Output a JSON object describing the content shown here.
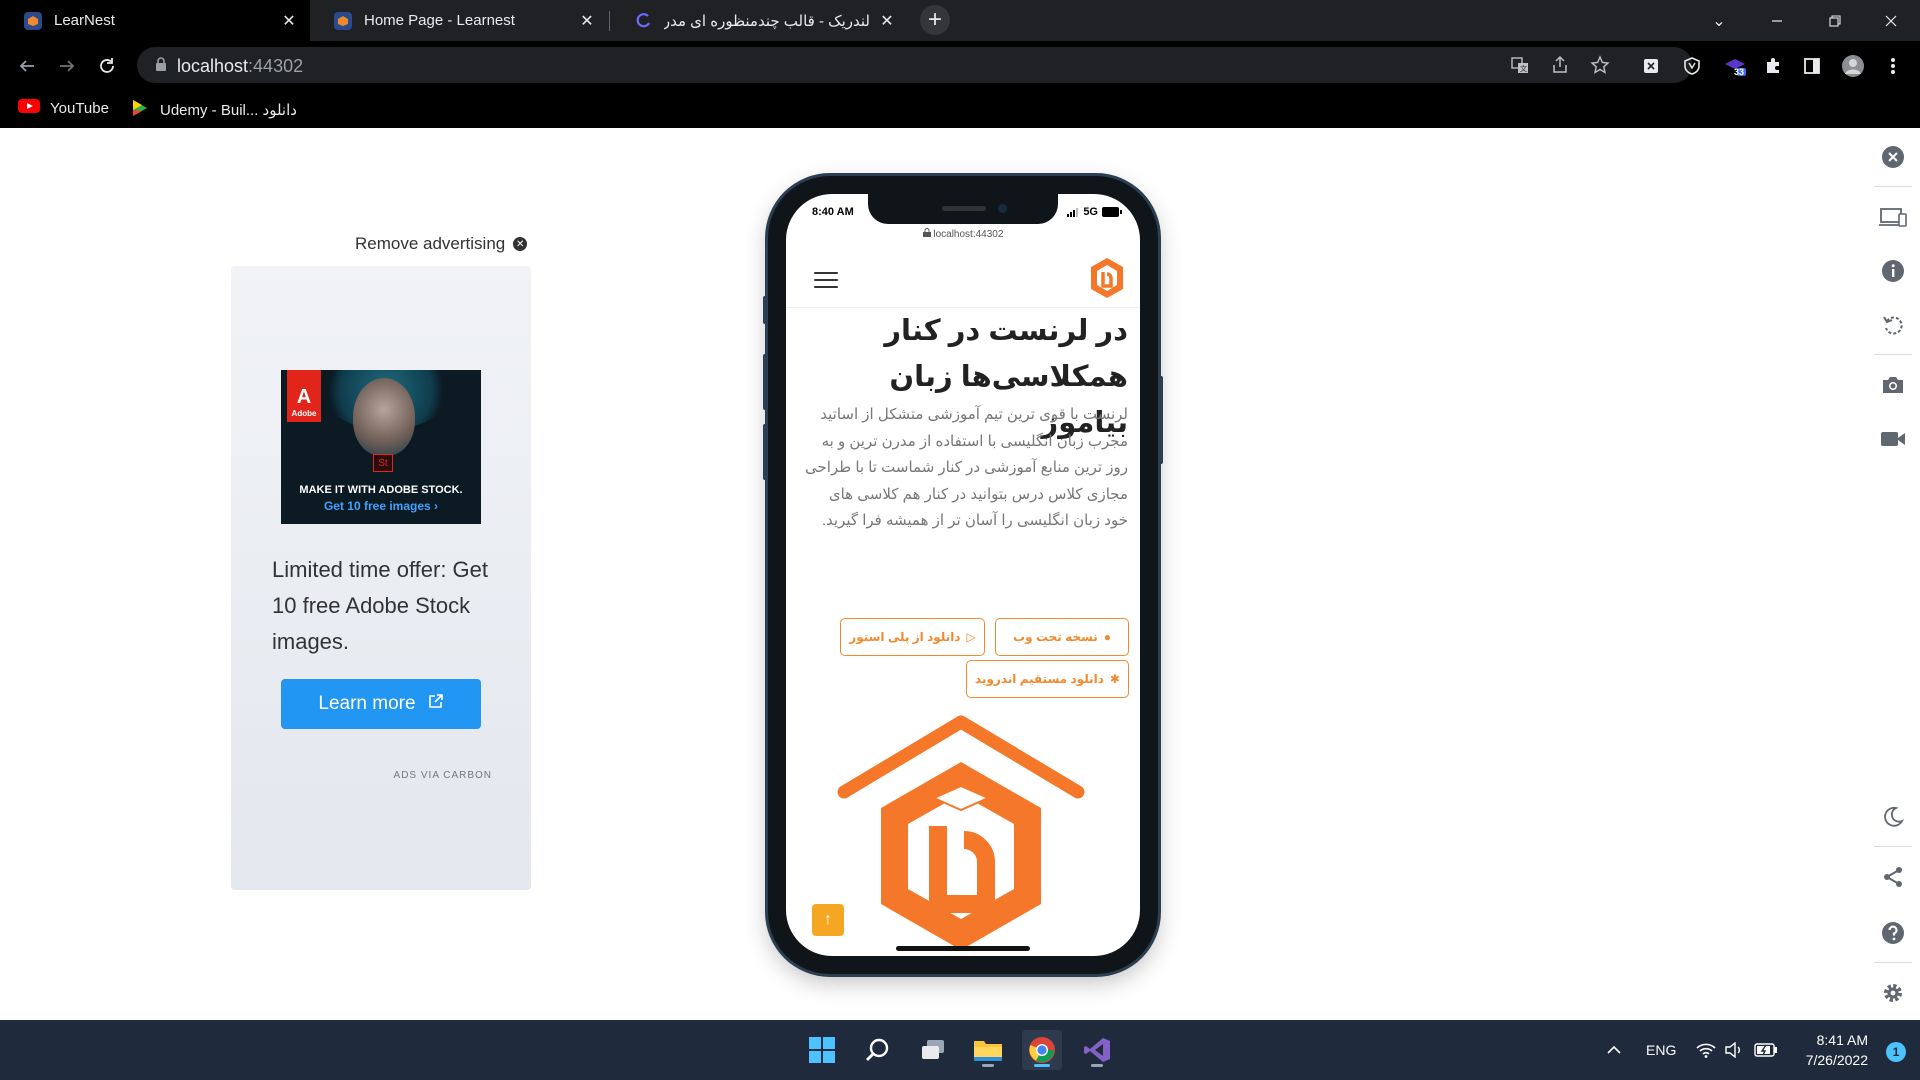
{
  "browser": {
    "tabs": [
      {
        "title": "LearNest",
        "active": true
      },
      {
        "title": "Home Page - Learnest",
        "active": false
      },
      {
        "title": "لندریک - قالب چندمنظوره ای مدرن",
        "active": false
      }
    ],
    "url_host": "localhost",
    "url_port": ":44302",
    "bookmarks": [
      {
        "label": "YouTube",
        "icon": "youtube-icon"
      },
      {
        "label": "Udemy - Buil... دانلود",
        "icon": "udemy-icon"
      }
    ],
    "extension_badge": "33"
  },
  "ad": {
    "remove_label": "Remove advertising",
    "image_line1": "MAKE IT WITH ADOBE STOCK.",
    "image_line2": "Get 10 free images ›",
    "adobe_label": "Adobe",
    "st_label": "St",
    "text": "Limited time offer: Get 10 free Adobe Stock images.",
    "button_label": "Learn more",
    "footer": "ADS VIA CARBON"
  },
  "phone": {
    "time": "8:40 AM",
    "network": "5G",
    "url": "localhost:44302",
    "headline": "در لرنست در کنار همکلاسی‌ها زبان بیاموز",
    "paragraph": "لرنست با قوی ترین تیم آموزشی متشکل از اساتید مجرب زبان انگلیسی با استفاده از مدرن ترین و به روز ترین منابع آموزشی در کنار شماست تا با طراحی مجازی کلاس درس بتوانید در کنار هم کلاسی های خود زبان انگلیسی را آسان تر از همیشه فرا گیرید.",
    "buttons": {
      "web": "نسخه تحت وب",
      "playstore": "دانلود از پلی استور",
      "android": "دانلود مستقیم اندروید"
    }
  },
  "taskbar": {
    "language": "ENG",
    "time": "8:41 AM",
    "date": "7/26/2022",
    "notifications": "1"
  },
  "colors": {
    "brand_orange": "#f08a2d",
    "ad_button": "#2196f3",
    "taskbar_bg": "#1f2a3c"
  }
}
